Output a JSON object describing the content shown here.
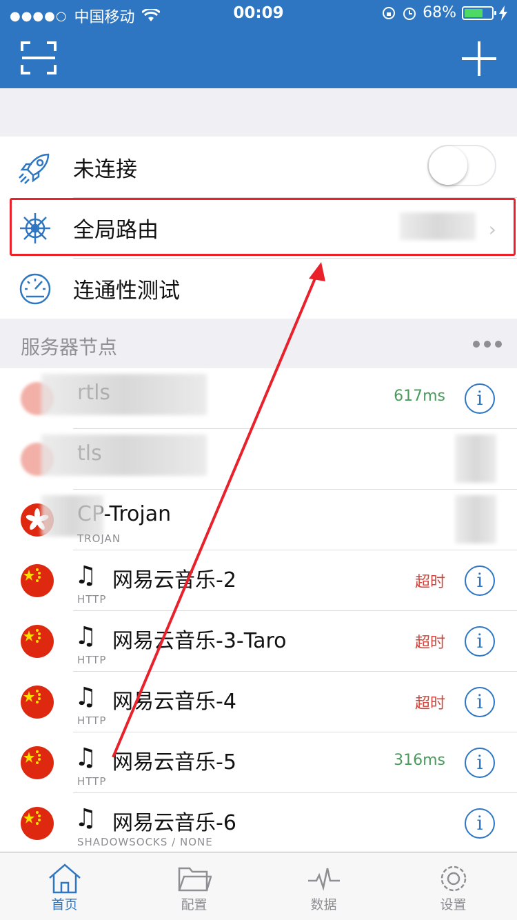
{
  "status": {
    "carrier": "中国移动",
    "time": "00:09",
    "battery": "68%",
    "battery_level": 0.68
  },
  "main": {
    "connection_label": "未连接",
    "routing_label": "全局路由",
    "test_label": "连通性测试",
    "toggle_on": false
  },
  "servers": {
    "section_title": "服务器节点",
    "items": [
      {
        "name": "rtls",
        "protocol": "",
        "latency": "617ms",
        "status": "ok",
        "flag": "blurred"
      },
      {
        "name": "tls",
        "protocol": "",
        "latency": "",
        "status": "ok",
        "flag": "blurred"
      },
      {
        "name": "CP-Trojan",
        "protocol": "TROJAN",
        "latency": "",
        "status": "ok",
        "flag": "hk"
      },
      {
        "name": "网易云音乐-2",
        "protocol": "HTTP",
        "latency": "超时",
        "status": "timeout",
        "flag": "cn"
      },
      {
        "name": "网易云音乐-3-Taro",
        "protocol": "HTTP",
        "latency": "超时",
        "status": "timeout",
        "flag": "cn"
      },
      {
        "name": "网易云音乐-4",
        "protocol": "HTTP",
        "latency": "超时",
        "status": "timeout",
        "flag": "cn"
      },
      {
        "name": "网易云音乐-5",
        "protocol": "HTTP",
        "latency": "316ms",
        "status": "ok",
        "flag": "cn"
      },
      {
        "name": "网易云音乐-6",
        "protocol": "SHADOWSOCKS / NONE",
        "latency": "",
        "status": "ok",
        "flag": "cn"
      }
    ]
  },
  "tabs": [
    {
      "label": "首页",
      "icon": "home-icon",
      "active": true
    },
    {
      "label": "配置",
      "icon": "folder-icon",
      "active": false
    },
    {
      "label": "数据",
      "icon": "pulse-icon",
      "active": false
    },
    {
      "label": "设置",
      "icon": "gear-icon",
      "active": false
    }
  ],
  "colors": {
    "brand": "#2e76c1",
    "highlight": "#e8212b",
    "ok": "#4a9a5c",
    "timeout": "#d0463d"
  }
}
